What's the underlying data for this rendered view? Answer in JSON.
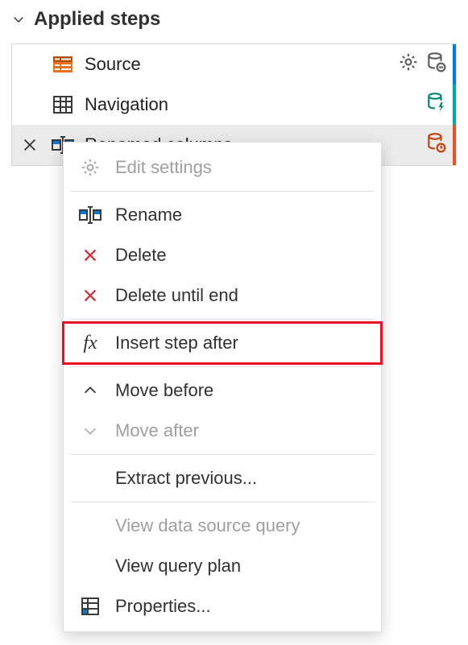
{
  "panel": {
    "title": "Applied steps"
  },
  "steps": [
    {
      "label": "Source"
    },
    {
      "label": "Navigation"
    },
    {
      "label": "Renamed columns"
    }
  ],
  "context_menu": {
    "edit_settings": "Edit settings",
    "rename": "Rename",
    "delete": "Delete",
    "delete_until_end": "Delete until end",
    "insert_step_after": "Insert step after",
    "move_before": "Move before",
    "move_after": "Move after",
    "extract_previous": "Extract previous...",
    "view_data_source_query": "View data source query",
    "view_query_plan": "View query plan",
    "properties": "Properties..."
  }
}
